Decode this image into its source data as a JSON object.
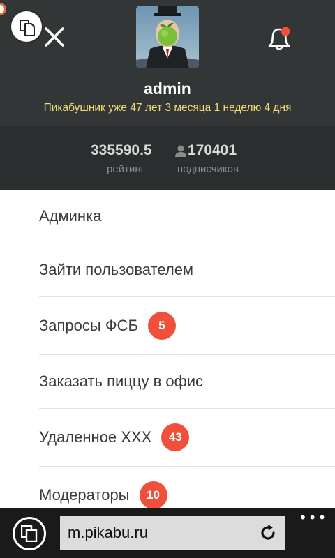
{
  "profile": {
    "username": "admin",
    "tenure": "Пикабушник уже 47 лет 3 месяца 1 неделю 4 дня"
  },
  "stats": {
    "rating_value": "335590.5",
    "rating_label": "рейтинг",
    "subscribers_value": "170401",
    "subscribers_label": "подписчиков"
  },
  "menu": {
    "items": [
      {
        "label": "Админка"
      },
      {
        "label": "Зайти пользователем"
      },
      {
        "label": "Запросы ФСБ",
        "badge": "5"
      },
      {
        "label": "Заказать пиццу в офис"
      },
      {
        "label": "Удаленное XXX",
        "badge": "43"
      },
      {
        "label": "Модераторы",
        "badge": "10"
      }
    ]
  },
  "browser": {
    "url": "m.pikabu.ru",
    "more_label": "•••"
  },
  "icons": {
    "close": "close-icon",
    "copy": "copy-icon",
    "bell": "bell-icon",
    "person": "person-icon",
    "tabs": "tabs-icon",
    "refresh": "refresh-icon",
    "more": "more-icon"
  },
  "colors": {
    "header_bg": "#323637",
    "stats_bg": "#2b2e2f",
    "tenure_text": "#f2dd74",
    "badge": "#f0503a",
    "notification_dot": "#f0503a",
    "browser_bar": "#1a1a1a"
  }
}
